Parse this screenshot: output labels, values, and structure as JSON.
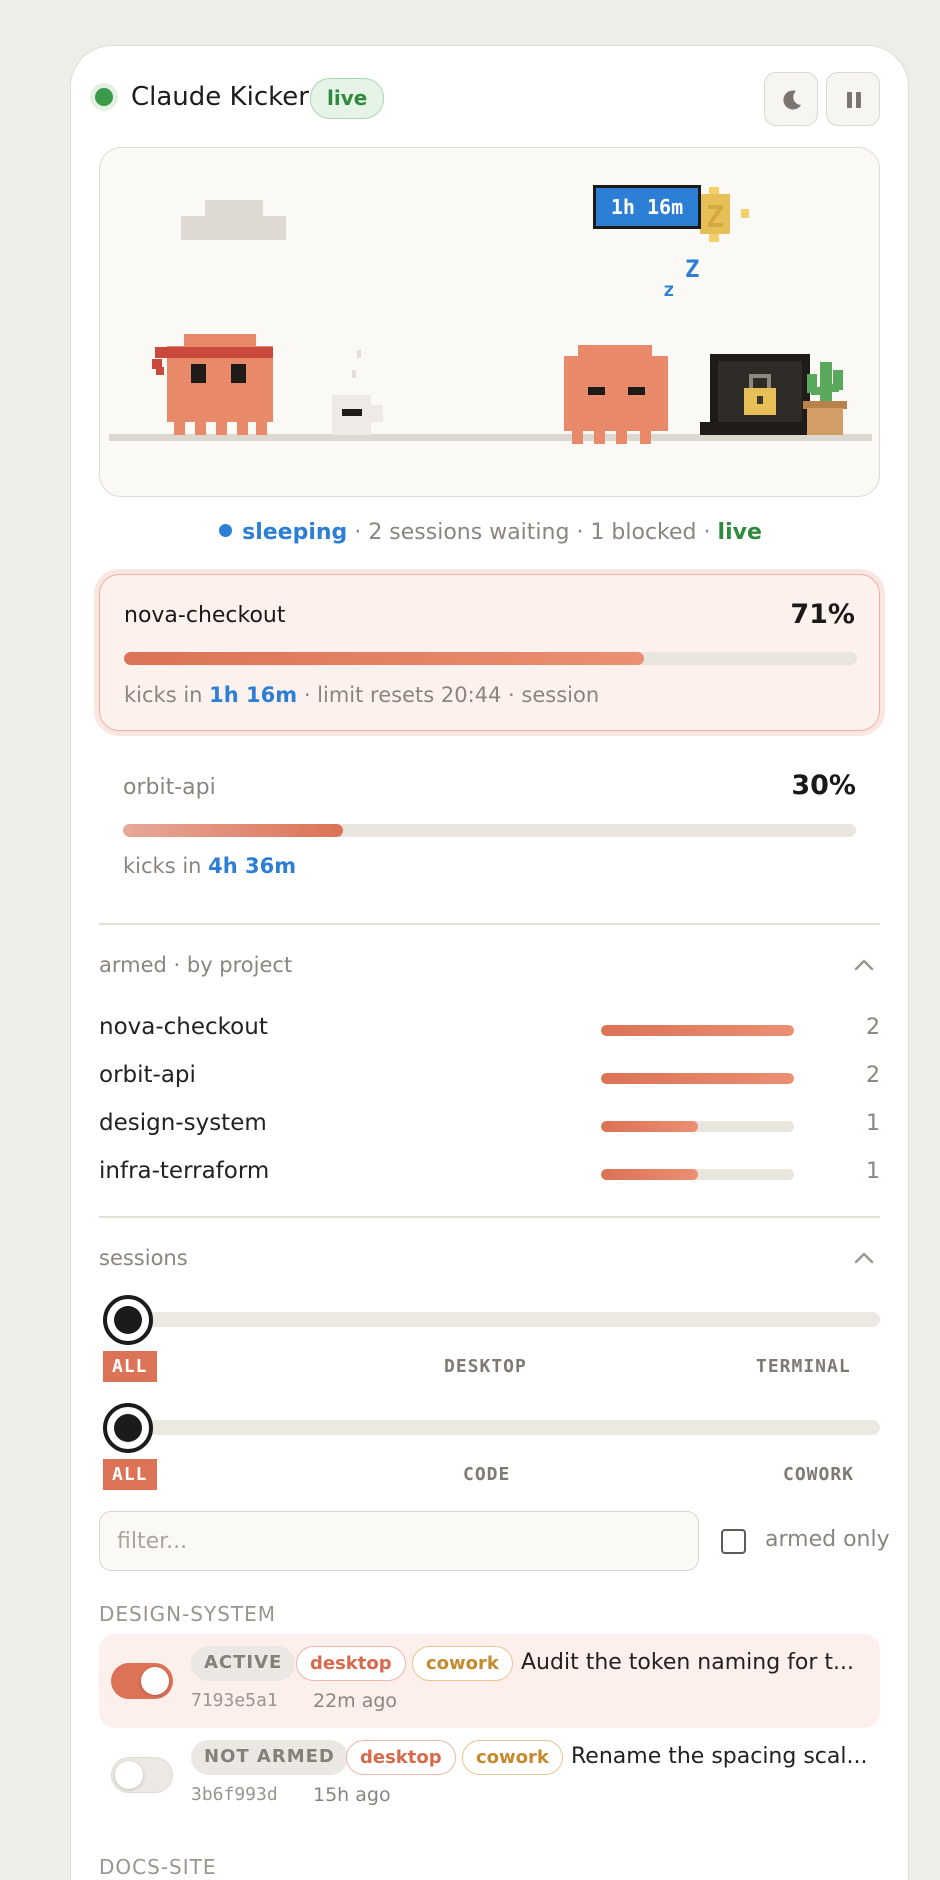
{
  "header": {
    "title": "Claude Kicker",
    "badge": "live"
  },
  "scene": {
    "timer": "1h 16m"
  },
  "status": {
    "state": "sleeping",
    "waiting": "2 sessions waiting",
    "blocked": "1 blocked",
    "live": "live",
    "separator": "·"
  },
  "usage": [
    {
      "name": "nova-checkout",
      "percent_label": "71%",
      "fraction": 0.71,
      "prefix": "kicks in",
      "eta": "1h 16m",
      "suffix": "· limit resets 20:44 · session"
    },
    {
      "name": "orbit-api",
      "percent_label": "30%",
      "fraction": 0.3,
      "prefix": "kicks in",
      "eta": "4h 36m",
      "suffix": ""
    }
  ],
  "armed": {
    "title": "armed · by project",
    "max": 2,
    "items": [
      {
        "name": "nova-checkout",
        "count": 2
      },
      {
        "name": "orbit-api",
        "count": 2
      },
      {
        "name": "design-system",
        "count": 1
      },
      {
        "name": "infra-terraform",
        "count": 1
      }
    ]
  },
  "sessions": {
    "title": "sessions",
    "source_filter": {
      "active": "ALL",
      "options": [
        "ALL",
        "DESKTOP",
        "TERMINAL"
      ]
    },
    "mode_filter": {
      "active": "ALL",
      "options": [
        "ALL",
        "CODE",
        "COWORK"
      ]
    },
    "filter_placeholder": "filter...",
    "armed_only_label": "armed only",
    "groups": [
      {
        "name": "DESIGN-SYSTEM",
        "items": [
          {
            "state": "ACTIVE",
            "source": "desktop",
            "mode": "cowork",
            "title": "Audit the token naming for t...",
            "id": "7193e5a1",
            "age": "22m ago",
            "armed": true
          },
          {
            "state": "NOT ARMED",
            "source": "desktop",
            "mode": "cowork",
            "title": "Rename the spacing scal...",
            "id": "3b6f993d",
            "age": "15h ago",
            "armed": false
          }
        ]
      },
      {
        "name": "DOCS-SITE",
        "items": []
      }
    ]
  },
  "colors": {
    "accent": "#dc7256",
    "blue": "#2c7fd4",
    "green": "#2f8a3e"
  }
}
